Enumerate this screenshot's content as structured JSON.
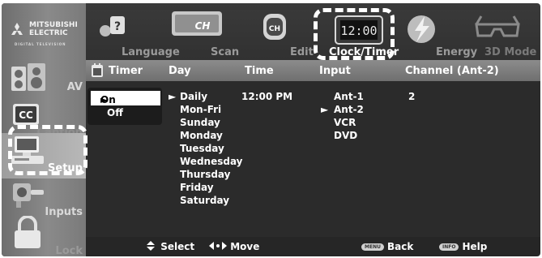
{
  "brand": {
    "line1": "MITSUBISHI",
    "line2": "ELECTRIC",
    "tagline": "DIGITAL TELEVISION"
  },
  "sidebar": {
    "items": [
      {
        "label": "AV",
        "icon": "speakers-icon"
      },
      {
        "label": "Caption",
        "icon": "cc-icon"
      },
      {
        "label": "Setup",
        "icon": "computer-icon"
      },
      {
        "label": "Inputs",
        "icon": "inputs-icon"
      },
      {
        "label": "Lock",
        "icon": "padlock-icon"
      }
    ]
  },
  "tabs": [
    {
      "label": "Language",
      "icon": "language-icon"
    },
    {
      "label": "Scan",
      "icon": "scan-channel-icon",
      "badge": "CH"
    },
    {
      "label": "Edit",
      "icon": "channel-edit-icon",
      "badge": "CH"
    },
    {
      "label": "Clock/Timer",
      "icon": "clock-icon",
      "badge": "12:00"
    },
    {
      "label": "Energy",
      "icon": "energy-icon"
    },
    {
      "label": "3D Mode",
      "icon": "3d-glasses-icon"
    }
  ],
  "table": {
    "headers": {
      "timer": "Timer",
      "day": "Day",
      "time": "Time",
      "input": "Input",
      "channel": "Channel (Ant-2)"
    },
    "timer_options": [
      "On",
      "Off"
    ],
    "timer_selected": "On",
    "days": [
      "Daily",
      "Mon-Fri",
      "Sunday",
      "Monday",
      "Tuesday",
      "Wednesday",
      "Thursday",
      "Friday",
      "Saturday"
    ],
    "day_selected": "Daily",
    "time_value": "12:00 PM",
    "inputs": [
      "Ant-1",
      "Ant-2",
      "VCR",
      "DVD"
    ],
    "input_selected": "Ant-2",
    "channel_value": "2",
    "selection_marker": "►"
  },
  "hints": {
    "select": "Select",
    "move": "Move",
    "back": "Back",
    "help": "Help",
    "menu_button": "MENU",
    "info_button": "INFO"
  }
}
